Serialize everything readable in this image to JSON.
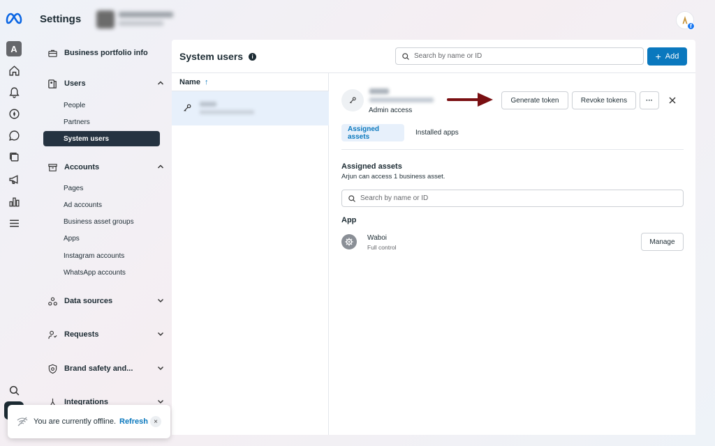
{
  "header": {
    "title": "Settings"
  },
  "nav": {
    "business_portfolio_info": "Business portfolio info",
    "users": {
      "label": "Users",
      "items": [
        "People",
        "Partners",
        "System users"
      ],
      "active": "System users"
    },
    "accounts": {
      "label": "Accounts",
      "items": [
        "Pages",
        "Ad accounts",
        "Business asset groups",
        "Apps",
        "Instagram accounts",
        "WhatsApp accounts"
      ]
    },
    "data_sources": "Data sources",
    "requests": "Requests",
    "brand_safety": "Brand safety and...",
    "integrations": "Integrations"
  },
  "main": {
    "title": "System users",
    "search_placeholder": "Search by name or ID",
    "add_label": "Add",
    "list": {
      "column_name": "Name",
      "sort_arrow": "↑"
    },
    "detail": {
      "role": "Admin access",
      "generate_token": "Generate token",
      "revoke_tokens": "Revoke tokens",
      "more": "···",
      "close": "×",
      "tabs": [
        "Assigned assets",
        "Installed apps"
      ],
      "active_tab": "Assigned assets",
      "section_title": "Assigned assets",
      "section_subtitle": "Arjun can access 1 business asset.",
      "asset_search_placeholder": "Search by name or ID",
      "app_heading": "App",
      "app": {
        "name": "Waboi",
        "permission": "Full control",
        "manage_label": "Manage"
      }
    }
  },
  "toast": {
    "message": "You are currently offline.",
    "refresh": "Refresh",
    "close": "×"
  },
  "rail": {
    "account_initial": "A"
  },
  "colors": {
    "primary": "#0a78be",
    "active_nav": "#253341",
    "selected_row": "#e7f0fb",
    "arrow_annotation": "#7a0f12"
  }
}
